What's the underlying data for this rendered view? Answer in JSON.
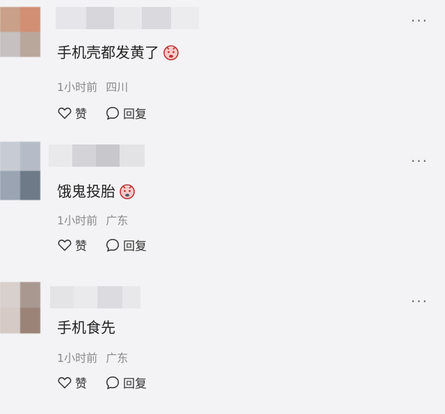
{
  "comments": [
    {
      "text": "手机壳都发黄了",
      "emoji": "crying-face-icon",
      "time": "1小时前",
      "location": "四川",
      "like_label": "赞",
      "reply_label": "回复",
      "more": "···",
      "avatar_colors": [
        "#c9a08a",
        "#d28f73",
        "#c6c0c0",
        "#b9a79c"
      ],
      "name_colors": [
        "#e6e6ea",
        "#d7d7db",
        "#e9e9ec",
        "#dadade",
        "#ececef"
      ]
    },
    {
      "text": "饿鬼投胎",
      "emoji": "crying-face-icon",
      "time": "1小时前",
      "location": "广东",
      "like_label": "赞",
      "reply_label": "回复",
      "more": "···",
      "avatar_colors": [
        "#c7ccd4",
        "#b5bcc7",
        "#9aa4b3",
        "#6f7a89"
      ],
      "name_colors": [
        "#e9e9ec",
        "#d4d4d8",
        "#c8c8cc",
        "#e3e3e6"
      ]
    },
    {
      "text": "手机食先",
      "emoji": "",
      "time": "1小时前",
      "location": "广东",
      "like_label": "赞",
      "reply_label": "回复",
      "more": "···",
      "avatar_colors": [
        "#d8d0cc",
        "#a89890",
        "#d5cac5",
        "#9b8378"
      ],
      "name_colors": [
        "#e4e4e7",
        "#eaeaed",
        "#dcdce0",
        "#e8e8eb"
      ]
    }
  ]
}
